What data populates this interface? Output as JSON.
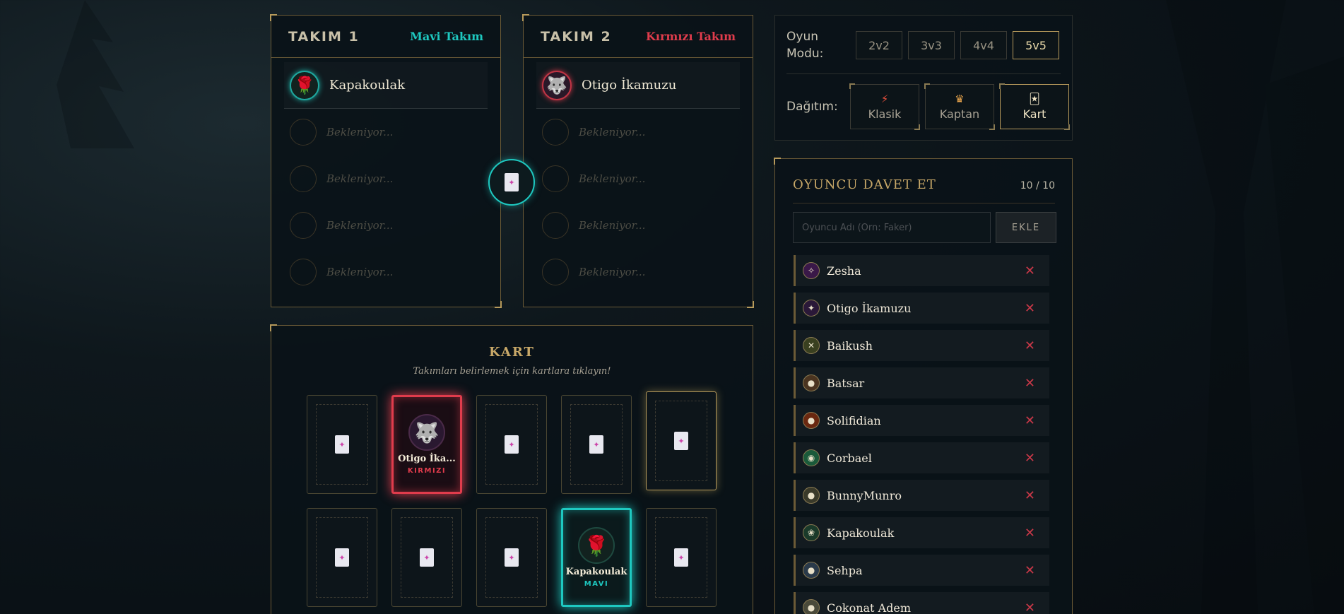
{
  "team1": {
    "title": "TAKIM 1",
    "tag": "Mavi Takım",
    "player": "Kapakoulak",
    "waiting": [
      "Bekleniyor...",
      "Bekleniyor...",
      "Bekleniyor...",
      "Bekleniyor..."
    ]
  },
  "team2": {
    "title": "TAKIM 2",
    "tag": "Kırmızı Takım",
    "player": "Otigo İkamuzu",
    "waiting": [
      "Bekleniyor...",
      "Bekleniyor...",
      "Bekleniyor...",
      "Bekleniyor..."
    ]
  },
  "settings": {
    "mode_label": "Oyun Modu:",
    "modes": [
      "2v2",
      "3v3",
      "4v4",
      "5v5"
    ],
    "active_mode": "5v5",
    "dist_label": "Dağıtım:",
    "dist_options": [
      {
        "label": "Klasik",
        "icon": "lightning-icon"
      },
      {
        "label": "Kaptan",
        "icon": "crown-icon"
      },
      {
        "label": "Kart",
        "icon": "card-icon"
      }
    ],
    "active_dist": "Kart"
  },
  "invite": {
    "title": "OYUNCU DAVET ET",
    "count": "10 / 10",
    "placeholder": "Oyuncu Adı (Örn: Faker)",
    "add_label": "EKLE",
    "players": [
      "Zesha",
      "Otigo İkamuzu",
      "Baikush",
      "Batsar",
      "Solifidian",
      "Corbael",
      "BunnyMunro",
      "Kapakoulak",
      "Sehpa",
      "Cokonat Adem"
    ]
  },
  "board": {
    "title": "KART",
    "subtitle": "Takımları belirlemek için kartlara tıklayın!",
    "revealed_red": {
      "name": "Otigo İka...",
      "team": "KIRMIZI"
    },
    "revealed_blue": {
      "name": "Kapakoulak",
      "team": "MAVI"
    }
  },
  "colors": {
    "blue": "#1ec8c0",
    "red": "#e03c4c",
    "gold": "#b79a5b"
  }
}
